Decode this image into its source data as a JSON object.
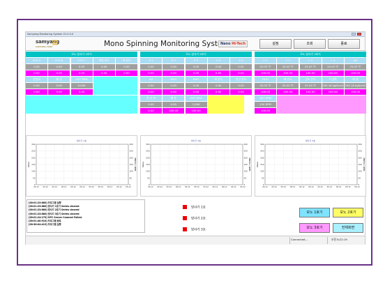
{
  "window": {
    "title": "Samyang Monitoring System V1.0.0.0"
  },
  "header": {
    "logo_text": "samyang",
    "logo_sub": "SAMYANG CORP",
    "app_title": "Mono Spinning Monitoring System",
    "badge_nano": "Nano",
    "badge_hitech": "Hi-Tech",
    "buttons": [
      "설정",
      "조회",
      "종료"
    ]
  },
  "colors": {
    "teal": "#00c2c2",
    "magenta": "#ff00ff",
    "yellow": "#ffff55",
    "cyan": "#66ffff",
    "pink": "#ff99ff",
    "frame": "#6a2f86"
  },
  "panels": [
    {
      "title": "모노 방사기 1호기",
      "row1_headers": [
        "ETS A",
        "ETS B",
        "ETS C",
        "미연 온도",
        "액 온도"
      ],
      "row1_values": [
        "0.00",
        "0.00",
        "0.00",
        "0.00",
        "0.00"
      ],
      "row1_set": [
        "0.00",
        "0.00",
        "0.00",
        "0.00",
        "0.00"
      ],
      "row2_headers": [
        "연신비",
        "배 온",
        "GST RPM"
      ],
      "row2_values": [
        "0.00",
        "0.00",
        "0.000"
      ],
      "row2_set": [
        "0.00",
        "5.00",
        "0.00"
      ]
    },
    {
      "title": "모노 방사기 2호기",
      "row1_headers": [
        "Z 1",
        "Z 2",
        "Z 3",
        "Z 4",
        "Z 5"
      ],
      "row1_values": [
        "0.00",
        "0.00",
        "0.00",
        "0.00",
        "0.00"
      ],
      "row1_set": [
        "0.00",
        "0.00",
        "0.00",
        "0.00",
        "0.00"
      ],
      "row2_headers": [
        "AD",
        "RHO",
        "RHO",
        "액 온도",
        "연신 온도"
      ],
      "row2_values": [
        "0.00",
        "0.00",
        "0.00",
        "0.00",
        "0.00"
      ],
      "row2_set": [
        "0.00",
        "0.00",
        "0.00",
        "0.00",
        "0.00"
      ],
      "row3_headers": [
        "연 신 비",
        "배 온",
        "GST RPM"
      ],
      "row3_values": [
        "0.00",
        "0.00",
        "1,000"
      ],
      "row3_set": [
        "0.00",
        "100.00",
        "100.00"
      ]
    },
    {
      "title": "모노 방사기 3호기",
      "row1_headers": [
        "C 1",
        "C 2",
        "C 3",
        "C 4",
        "AD"
      ],
      "row1_values": [
        "25.03 ℃",
        "25.03 ℃",
        "25.03 ℃",
        "25.03 ℃",
        "25.03 ℃"
      ],
      "row1_set": [
        "100.00",
        "100.00",
        "100.00",
        "100.00",
        "100.00"
      ],
      "row2_headers": [
        "RHO",
        "배 온도",
        "건조 온도",
        "P 압력",
        "배 관"
      ],
      "row2_values": [
        "25.03 ℃",
        "25.03 ℃",
        "25.03 ℃",
        "250.16 kgf/cm2",
        "250.16 kgf/cm2"
      ],
      "row2_set": [
        "100.00",
        "100.00",
        "100.00",
        "100.00",
        "100.00"
      ],
      "row3_headers": [
        "GST RPM"
      ],
      "row3_values": [
        "200 RPM"
      ],
      "row3_set": [
        "100.00"
      ]
    }
  ],
  "charts": [
    {
      "title": "방사기 1호",
      "ylabel": "Value",
      "y2label": "PRESS / RPM",
      "y_ticks": [
        "300",
        "250",
        "200",
        "150",
        "100",
        "50",
        "0"
      ],
      "x_ticks": [
        "05:12",
        "05:12",
        "05:12",
        "05:12",
        "05:12",
        "05:12",
        "05:12",
        "05:12",
        "05:12",
        "05:12",
        "05:12"
      ]
    },
    {
      "title": "방사기 2호",
      "ylabel": "Value",
      "y2label": "PRESS / RPM",
      "y_ticks": [
        "300",
        "250",
        "200",
        "150",
        "100",
        "50",
        "0"
      ],
      "x_ticks": [
        "05:12",
        "05:12",
        "05:12",
        "05:12",
        "05:12",
        "05:12",
        "05:12",
        "05:12",
        "05:12",
        "05:12",
        "05:12"
      ]
    },
    {
      "title": "방사기 3호",
      "ylabel": "Value",
      "y2label": "PRESS / RPM",
      "y_ticks": [
        "300",
        "250",
        "200",
        "150",
        "100",
        "50",
        "0"
      ],
      "x_ticks": [
        "05:12",
        "05:12",
        "05:12",
        "05:12",
        "05:12",
        "05:12",
        "05:12",
        "05:12",
        "05:12",
        "05:12",
        "05:12"
      ]
    }
  ],
  "log": [
    "[00:01:23:880] 프로그램 실행",
    "[00:01:23:880] 방사기 1호기 Series cleared",
    "[00:01:23:880] 방사기 2호기 Series cleared",
    "[00:01:23:880] 방사기 3호기 Series cleared",
    "[00:01:24:170] OPC Server Connect Failed.",
    "[00:01:40:910] 프로그램 종료",
    "[00:38:04:413] 프로그램 실행"
  ],
  "status_items": [
    "방사기 1호",
    "방사기 2호",
    "방사기 3호"
  ],
  "big_buttons": [
    "모노 1호기",
    "모노 2호기",
    "모노 3호기",
    "전체화면"
  ],
  "statusbar": {
    "connection": "Connected...",
    "time": "오전 8:22:19"
  }
}
